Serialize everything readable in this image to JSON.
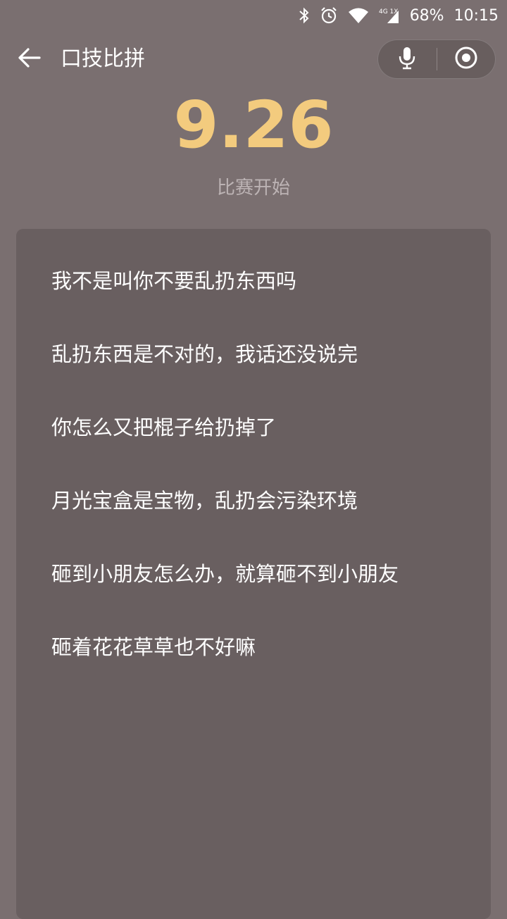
{
  "status_bar": {
    "network": "4G 1X",
    "battery": "68%",
    "time": "10:15"
  },
  "header": {
    "title": "口技比拼"
  },
  "score": {
    "value": "9.26",
    "status": "比赛开始"
  },
  "lyrics": [
    "我不是叫你不要乱扔东西吗",
    "乱扔东西是不对的，我话还没说完",
    "你怎么又把棍子给扔掉了",
    "月光宝盒是宝物，乱扔会污染环境",
    "砸到小朋友怎么办，就算砸不到小朋友",
    "砸着花花草草也不好嘛"
  ],
  "colors": {
    "background": "#7a6f70",
    "card": "#695f60",
    "score": "#f3cb7e"
  }
}
